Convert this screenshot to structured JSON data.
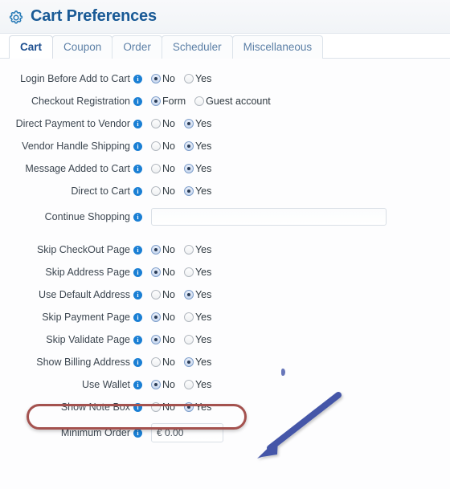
{
  "header": {
    "title": "Cart Preferences",
    "icon": "gear-icon"
  },
  "tabs": [
    {
      "label": "Cart",
      "active": true
    },
    {
      "label": "Coupon",
      "active": false
    },
    {
      "label": "Order",
      "active": false
    },
    {
      "label": "Scheduler",
      "active": false
    },
    {
      "label": "Miscellaneous",
      "active": false
    }
  ],
  "form": {
    "info_glyph": "i",
    "rows": [
      {
        "label": "Login Before Add to Cart",
        "type": "radio",
        "options": [
          {
            "label": "No",
            "checked": true
          },
          {
            "label": "Yes",
            "checked": false
          }
        ]
      },
      {
        "label": "Checkout Registration",
        "type": "radio",
        "options": [
          {
            "label": "Form",
            "checked": true
          },
          {
            "label": "Guest account",
            "checked": false
          }
        ]
      },
      {
        "label": "Direct Payment to Vendor",
        "type": "radio",
        "options": [
          {
            "label": "No",
            "checked": false
          },
          {
            "label": "Yes",
            "checked": true
          }
        ]
      },
      {
        "label": "Vendor Handle Shipping",
        "type": "radio",
        "options": [
          {
            "label": "No",
            "checked": false
          },
          {
            "label": "Yes",
            "checked": true
          }
        ]
      },
      {
        "label": "Message Added to Cart",
        "type": "radio",
        "options": [
          {
            "label": "No",
            "checked": false
          },
          {
            "label": "Yes",
            "checked": true
          }
        ]
      },
      {
        "label": "Direct to Cart",
        "type": "radio",
        "options": [
          {
            "label": "No",
            "checked": false
          },
          {
            "label": "Yes",
            "checked": true
          }
        ]
      },
      {
        "label": "Continue Shopping",
        "type": "text",
        "value": "",
        "placeholder": ""
      },
      {
        "label": "Skip CheckOut Page",
        "type": "radio",
        "gap": true,
        "options": [
          {
            "label": "No",
            "checked": true
          },
          {
            "label": "Yes",
            "checked": false
          }
        ]
      },
      {
        "label": "Skip Address Page",
        "type": "radio",
        "options": [
          {
            "label": "No",
            "checked": true
          },
          {
            "label": "Yes",
            "checked": false
          }
        ]
      },
      {
        "label": "Use Default Address",
        "type": "radio",
        "options": [
          {
            "label": "No",
            "checked": false
          },
          {
            "label": "Yes",
            "checked": true
          }
        ]
      },
      {
        "label": "Skip Payment Page",
        "type": "radio",
        "options": [
          {
            "label": "No",
            "checked": true
          },
          {
            "label": "Yes",
            "checked": false
          }
        ]
      },
      {
        "label": "Skip Validate Page",
        "type": "radio",
        "options": [
          {
            "label": "No",
            "checked": true
          },
          {
            "label": "Yes",
            "checked": false
          }
        ]
      },
      {
        "label": "Show Billing Address",
        "type": "radio",
        "options": [
          {
            "label": "No",
            "checked": false
          },
          {
            "label": "Yes",
            "checked": true
          }
        ]
      },
      {
        "label": "Use Wallet",
        "type": "radio",
        "highlighted": true,
        "options": [
          {
            "label": "No",
            "checked": true
          },
          {
            "label": "Yes",
            "checked": false
          }
        ]
      },
      {
        "label": "Show Note Box",
        "type": "radio",
        "options": [
          {
            "label": "No",
            "checked": false
          },
          {
            "label": "Yes",
            "checked": true
          }
        ]
      },
      {
        "label": "Minimum Order",
        "type": "text",
        "value": "€ 0.00",
        "placeholder": ""
      }
    ]
  },
  "annotations": {
    "highlight": {
      "target_label": "Use Wallet",
      "color": "#a4524f",
      "shape": "rounded-rectangle"
    },
    "arrow": {
      "color": "#4457a8",
      "direction": "down-left",
      "points_at": "Use Wallet"
    }
  },
  "colors": {
    "title": "#1a5a96",
    "tab_active": "#1c4e8f",
    "tab_inactive": "#5b7fa6",
    "info_icon": "#1a7fd4",
    "highlight": "#a4524f",
    "arrow": "#4457a8"
  }
}
